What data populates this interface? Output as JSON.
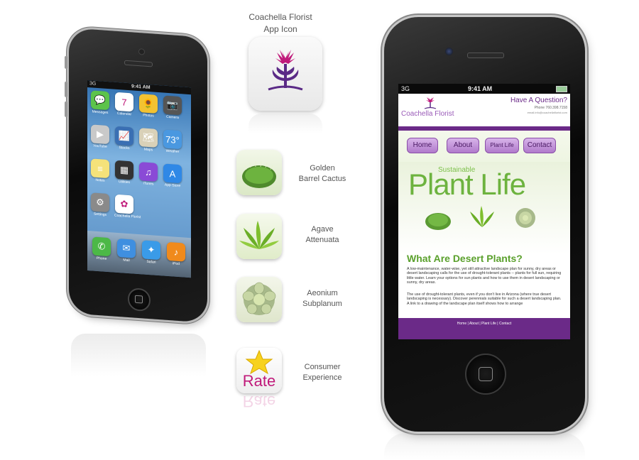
{
  "left_phone": {
    "status": {
      "carrier": "3G",
      "time": "9:41 AM"
    },
    "apps": [
      {
        "label": "Messages",
        "icon": "messages-icon",
        "color": "#5cc34b",
        "glyph": "💬"
      },
      {
        "label": "Calendar",
        "icon": "calendar-icon",
        "color": "#ffffff",
        "glyph": "7"
      },
      {
        "label": "Photos",
        "icon": "photos-icon",
        "color": "#f2c232",
        "glyph": "🌻"
      },
      {
        "label": "Camera",
        "icon": "camera-icon",
        "color": "#555555",
        "glyph": "📷"
      },
      {
        "label": "YouTube",
        "icon": "youtube-icon",
        "color": "#c9c9c9",
        "glyph": "▶"
      },
      {
        "label": "Stocks",
        "icon": "stocks-icon",
        "color": "#3a6fb3",
        "glyph": "📈"
      },
      {
        "label": "Maps",
        "icon": "maps-icon",
        "color": "#d9d1b8",
        "glyph": "🗺"
      },
      {
        "label": "Weather",
        "icon": "weather-icon",
        "color": "#4a98e0",
        "glyph": "73°"
      },
      {
        "label": "Notes",
        "icon": "notes-icon",
        "color": "#f5e27a",
        "glyph": "≡"
      },
      {
        "label": "Utilities",
        "icon": "utilities-icon",
        "color": "#333333",
        "glyph": "▦"
      },
      {
        "label": "iTunes",
        "icon": "itunes-icon",
        "color": "#8a4ad6",
        "glyph": "♫"
      },
      {
        "label": "App Store",
        "icon": "appstore-icon",
        "color": "#2f88e6",
        "glyph": "A"
      },
      {
        "label": "Settings",
        "icon": "settings-icon",
        "color": "#8a8a8a",
        "glyph": "⚙"
      },
      {
        "label": "Coachella Florist",
        "icon": "coachella-florist-icon",
        "color": "#ffffff",
        "glyph": "✿"
      }
    ],
    "dock": [
      {
        "label": "Phone",
        "icon": "phone-icon",
        "color": "#4cb847",
        "glyph": "✆"
      },
      {
        "label": "Mail",
        "icon": "mail-icon",
        "color": "#3f8fe0",
        "glyph": "✉"
      },
      {
        "label": "Safari",
        "icon": "safari-icon",
        "color": "#3a9be8",
        "glyph": "✦"
      },
      {
        "label": "iPod",
        "icon": "ipod-icon",
        "color": "#f08a1c",
        "glyph": "♪"
      }
    ]
  },
  "middle": {
    "app_icon_title_1": "Coachella Florist",
    "app_icon_title_2": "App Icon",
    "items": [
      {
        "line1": "Golden",
        "line2": "Barrel Cactus",
        "icon": "golden-barrel-cactus-icon"
      },
      {
        "line1": "Agave",
        "line2": "Attenuata",
        "icon": "agave-attenuata-icon"
      },
      {
        "line1": "Aeonium",
        "line2": "Subplanum",
        "icon": "aeonium-subplanum-icon"
      },
      {
        "line1": "Consumer",
        "line2": "Experience",
        "icon": "rate-icon"
      }
    ],
    "rate_label": "Rate"
  },
  "right_phone": {
    "status": {
      "carrier": "3G",
      "time": "9:41 AM"
    },
    "brand": "Coachella Florist",
    "question": "Have A Question?",
    "phone": "Phone 760.398.7158",
    "email": "email.info@coachellaflorist.com",
    "nav": [
      "Home",
      "About",
      "Plant Life",
      "Contact"
    ],
    "hero_small": "Sustainable",
    "hero_big": "Plant Life",
    "heading": "What Are Desert Plants?",
    "para1": "A low-maintenance, water-wise, yet still attractive landscape plan for sunny, dry areas or desert landscaping calls for the use of drought-tolerant plants -- plants for full sun, requiring little water. Learn your options for sun plants and how to use them in desert landscaping or sunny, dry areas.",
    "para2": "The use of drought-tolerant plants, even if you don't live in Arizona (where true desert landscaping is necessary). Discover perennials suitable for such a desert landscaping plan. A link to a drawing of the landscape plan itself shows how to arrange",
    "footer": "Home | About | Plant Life | Contact"
  },
  "colors": {
    "purple": "#6b2a88",
    "green": "#6db33f",
    "lavender": "#c49ad9"
  }
}
